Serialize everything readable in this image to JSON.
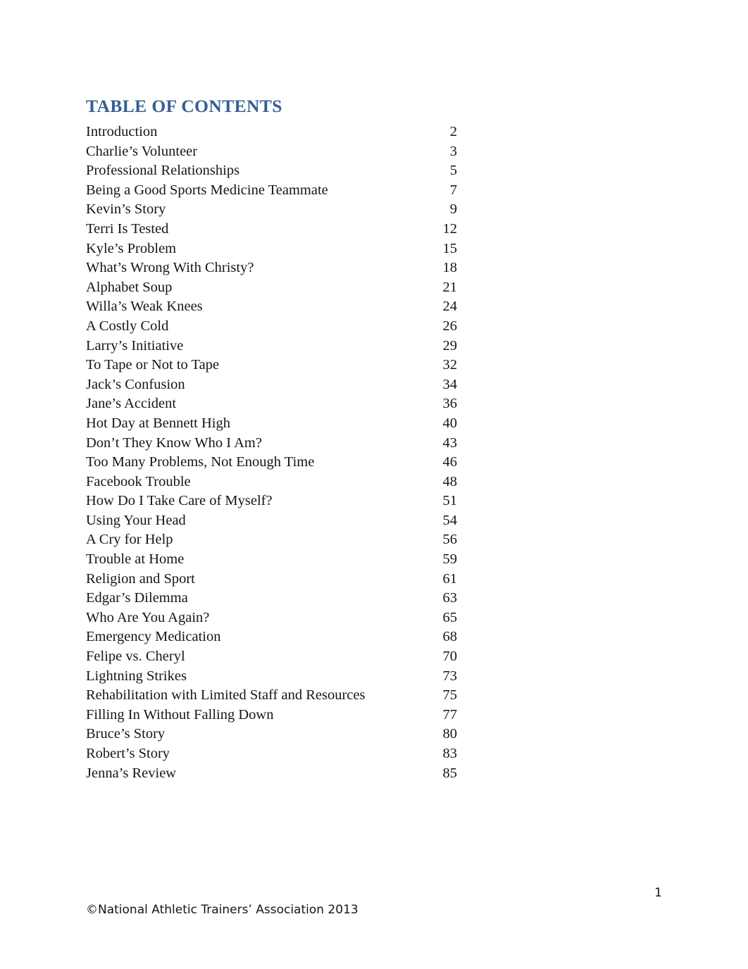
{
  "document": {
    "heading": "TABLE OF CONTENTS",
    "heading_color": "#365F91",
    "body_color": "#161616",
    "background_color": "#ffffff"
  },
  "toc": {
    "entries": [
      {
        "title": "Introduction",
        "page": "2"
      },
      {
        "title": "Charlie’s Volunteer",
        "page": "3"
      },
      {
        "title": "Professional Relationships",
        "page": "5"
      },
      {
        "title": "Being a Good Sports Medicine Teammate",
        "page": "7"
      },
      {
        "title": "Kevin’s Story",
        "page": "9"
      },
      {
        "title": "Terri Is Tested",
        "page": "12"
      },
      {
        "title": "Kyle’s Problem",
        "page": "15"
      },
      {
        "title": "What’s Wrong With Christy?",
        "page": "18"
      },
      {
        "title": "Alphabet Soup",
        "page": "21"
      },
      {
        "title": "Willa’s Weak Knees",
        "page": "24"
      },
      {
        "title": "A Costly Cold",
        "page": "26"
      },
      {
        "title": "Larry’s Initiative",
        "page": "29"
      },
      {
        "title": "To Tape or Not to Tape",
        "page": "32"
      },
      {
        "title": "Jack’s Confusion",
        "page": "34"
      },
      {
        "title": "Jane’s Accident",
        "page": "36"
      },
      {
        "title": "Hot Day at Bennett High",
        "page": "40"
      },
      {
        "title": "Don’t They Know Who I Am?",
        "page": "43"
      },
      {
        "title": "Too Many Problems, Not Enough Time",
        "page": "46"
      },
      {
        "title": "Facebook Trouble",
        "page": "48"
      },
      {
        "title": "How Do I Take Care of Myself?",
        "page": "51"
      },
      {
        "title": "Using Your Head",
        "page": "54"
      },
      {
        "title": "A Cry for Help",
        "page": "56"
      },
      {
        "title": "Trouble at Home",
        "page": "59"
      },
      {
        "title": "Religion and Sport",
        "page": "61"
      },
      {
        "title": "Edgar’s Dilemma",
        "page": "63"
      },
      {
        "title": "Who Are You Again?",
        "page": "65"
      },
      {
        "title": "Emergency Medication",
        "page": "68"
      },
      {
        "title": "Felipe vs. Cheryl",
        "page": "70"
      },
      {
        "title": "Lightning Strikes",
        "page": "73"
      },
      {
        "title": "Rehabilitation with Limited Staff and Resources",
        "page": "75"
      },
      {
        "title": "Filling In Without Falling Down",
        "page": "77"
      },
      {
        "title": "Bruce’s Story",
        "page": "80"
      },
      {
        "title": "Robert’s Story",
        "page": "83"
      },
      {
        "title": "Jenna’s Review",
        "page": "85"
      }
    ]
  },
  "footer": {
    "copyright": "©National Athletic Trainers’ Association 2013",
    "page_number": "1"
  }
}
